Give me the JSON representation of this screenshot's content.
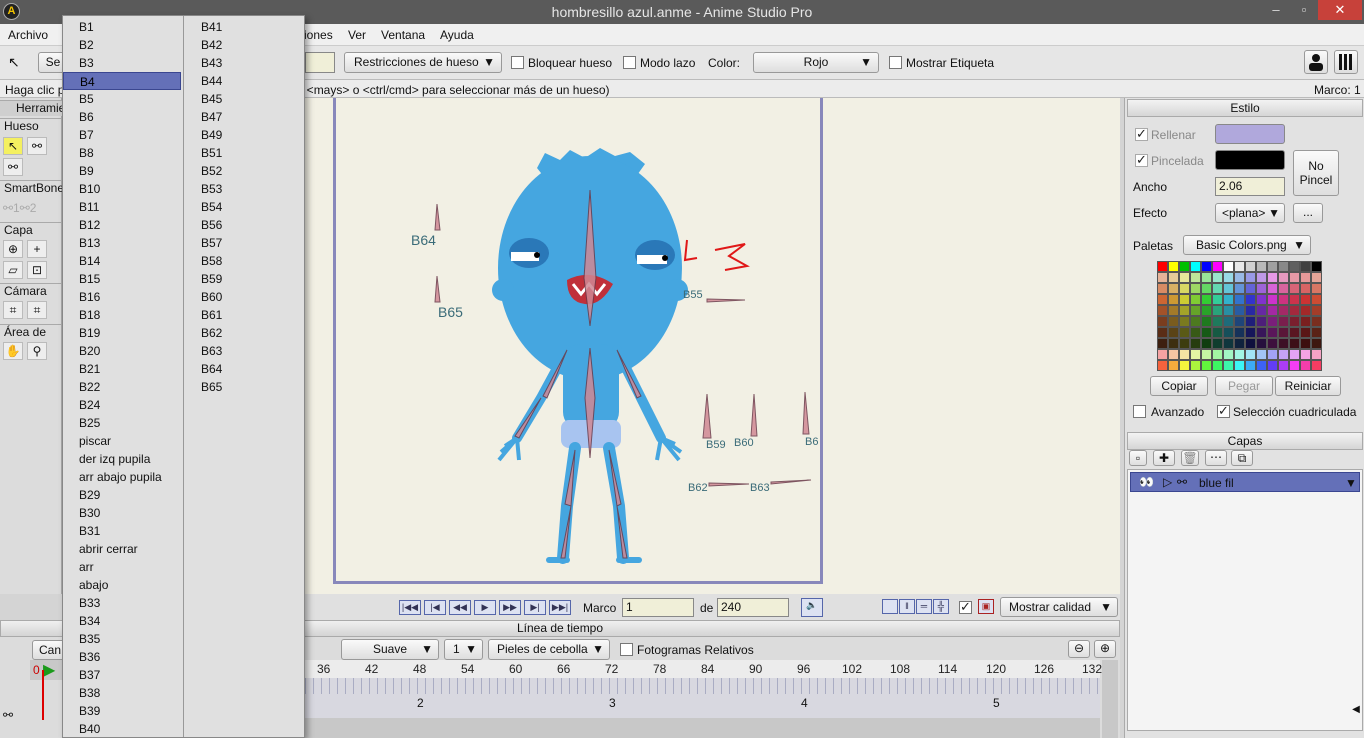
{
  "window": {
    "title": "hombresillo azul.anme - Anime Studio Pro",
    "app_icon": "A",
    "minimize": "‒",
    "restore": "▫",
    "close": "✕"
  },
  "menu": [
    "Archivo",
    "iones",
    "Ver",
    "Ventana",
    "Ayuda"
  ],
  "tool_options": {
    "select_label": "Se",
    "restrictions": "Restricciones de hueso",
    "lock_bone": "Bloquear hueso",
    "lasso_mode": "Modo lazo",
    "color_label": "Color:",
    "color_value": "Rojo",
    "show_label": "Mostrar Etiqueta"
  },
  "status": {
    "hint_left": "Haga clic p",
    "hint_right": "do <mays> o <ctrl/cmd> para seleccionar más de un hueso)",
    "frame": "Marco: 1"
  },
  "tools": {
    "header": "Herramie",
    "hueso": "Hueso",
    "smartbones": "SmartBone",
    "capa": "Capa",
    "camara": "Cámara",
    "area": "Área de tra"
  },
  "dropdown": {
    "col1": [
      "B1",
      "B2",
      "B3",
      "B4",
      "B5",
      "B6",
      "B7",
      "B8",
      "B9",
      "B10",
      "B11",
      "B12",
      "B13",
      "B14",
      "B15",
      "B16",
      "B18",
      "B19",
      "B20",
      "B21",
      "B22",
      "B24",
      "B25",
      "piscar",
      "der izq pupila",
      "arr abajo pupila",
      "B29",
      "B30",
      "B31",
      "abrir cerrar",
      "arr",
      "abajo",
      "B33",
      "B34",
      "B35",
      "B36",
      "B37",
      "B38",
      "B39",
      "B40"
    ],
    "col2": [
      "B41",
      "B42",
      "B43",
      "B44",
      "B45",
      "B47",
      "B49",
      "B51",
      "B52",
      "B53",
      "B54",
      "B56",
      "B57",
      "B58",
      "B59",
      "B60",
      "B61",
      "B62",
      "B63",
      "B64",
      "B65"
    ],
    "selected": "B4"
  },
  "canvas": {
    "bone_labels": [
      "B64",
      "B65",
      "B55",
      "B59",
      "B60",
      "B6",
      "B62",
      "B63"
    ]
  },
  "playback": {
    "frame_label": "Marco",
    "frame_value": "1",
    "of_label": "de",
    "total": "240",
    "quality": "Mostrar calidad"
  },
  "timeline": {
    "title": "Línea de tiempo",
    "interp": "Suave",
    "interp_num": "1",
    "onion": "Pieles de cebolla",
    "relative": "Fotogramas Relativos",
    "tab": "Can",
    "ruler": [
      "36",
      "42",
      "48",
      "54",
      "60",
      "66",
      "72",
      "78",
      "84",
      "90",
      "96",
      "102",
      "108",
      "114",
      "120",
      "126",
      "132"
    ],
    "ruler2": [
      "2",
      "3",
      "4",
      "5"
    ],
    "frame_zero": "0"
  },
  "style": {
    "header": "Estilo",
    "fill": "Rellenar",
    "stroke": "Pincelada",
    "fill_color": "#b0a8dc",
    "stroke_color": "#000000",
    "no_brush": "No Pincel",
    "width_label": "Ancho",
    "width_value": "2.06",
    "effect_label": "Efecto",
    "effect_value": "<plana>",
    "effect_more": "...",
    "palettes_label": "Paletas",
    "palette_value": "Basic Colors.png",
    "copy": "Copiar",
    "paste": "Pegar",
    "reset": "Reiniciar",
    "advanced": "Avanzado",
    "grid_select": "Selección cuadriculada"
  },
  "layers": {
    "header": "Capas",
    "items": [
      {
        "name": "blue fil"
      }
    ]
  }
}
